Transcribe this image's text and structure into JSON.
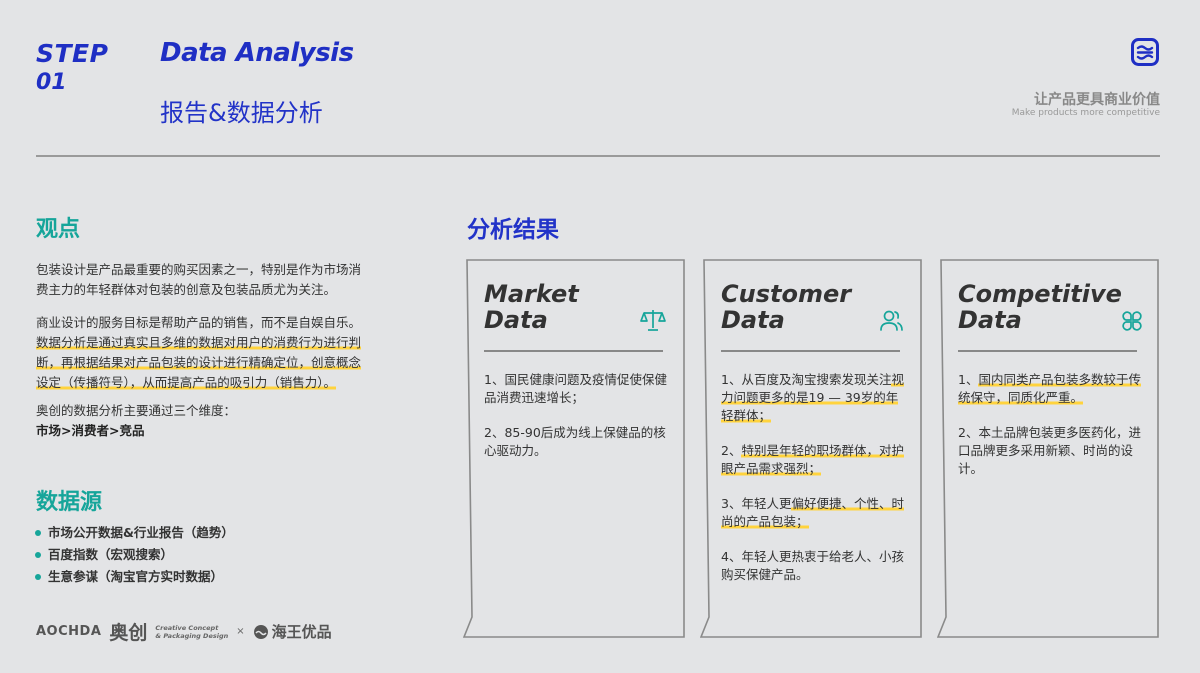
{
  "header": {
    "step": "STEP",
    "step_num": "01",
    "title_en": "Data Analysis",
    "title_cn": "报告&数据分析",
    "tagline_cn": "让产品更具商业价值",
    "tagline_en": "Make products more competitive",
    "logo_icon": "menu-waves-icon"
  },
  "view": {
    "title": "观点",
    "p1": "包装设计是产品最重要的购买因素之一，特别是作为市场消费主力的年轻群体对包装的创意及包装品质尤为关注。",
    "p2_plain": "商业设计的服务目标是帮助产品的销售，而不是自娱自乐。",
    "p2_hl": "数据分析是通过真实且多维的数据对用户的消费行为进行判断，再根据结果对产品包装的设计进行精确定位，创意概念设定（传播符号），从而提高产品的吸引力（销售力）。",
    "p3": "奥创的数据分析主要通过三个维度：",
    "p3_bold": "市场>消费者>竞品"
  },
  "sources": {
    "title": "数据源",
    "items": [
      "市场公开数据&行业报告（趋势）",
      "百度指数（宏观搜索）",
      "生意参谋（淘宝官方实时数据）"
    ]
  },
  "footer": {
    "aochda": "AOCHDA",
    "cn": "奥创",
    "small1": "Creative Concept",
    "small2": "& Packaging Design",
    "x": "×",
    "brand": "海王优品"
  },
  "results": {
    "title": "分析结果",
    "cards": [
      {
        "title1": "Market",
        "title2": "Data",
        "icon": "scale-icon",
        "items": [
          {
            "pre": "1、国民健康问题及疫情促使保健品消费迅速增长；",
            "hl": "",
            "post": ""
          },
          {
            "pre": "2、85-90后成为线上保健品的核心驱动力。",
            "hl": "",
            "post": ""
          }
        ]
      },
      {
        "title1": "Customer",
        "title2": "Data",
        "icon": "users-icon",
        "items": [
          {
            "pre": "1、从百度及淘宝搜索发现关注",
            "hl": "视力问题更多的是19 — 39岁的年轻群体；",
            "post": ""
          },
          {
            "pre": "2、",
            "hl": "特别是年轻的职场群体，对护眼产品需求强烈；",
            "post": ""
          },
          {
            "pre": "3、年轻人更",
            "hl": "偏好便捷、个性、时尚的产品包装；",
            "post": ""
          },
          {
            "pre": "4、年轻人更热衷于给老人、小孩购买保健产品。",
            "hl": "",
            "post": ""
          }
        ]
      },
      {
        "title1": "Competitive",
        "title2": "Data",
        "icon": "clover-icon",
        "items": [
          {
            "pre": "1、",
            "hl": "国内同类产品包装多数较于传统保守，同质化严重。",
            "post": ""
          },
          {
            "pre": "2、本土品牌包装更多医药化，进口品牌更多采用新颖、时尚的设计。",
            "hl": "",
            "post": ""
          }
        ]
      }
    ]
  },
  "colors": {
    "accent_blue": "#1f2fc4",
    "accent_teal": "#16a59a",
    "highlight": "#ffd33d",
    "background": "#e3e4e6"
  }
}
